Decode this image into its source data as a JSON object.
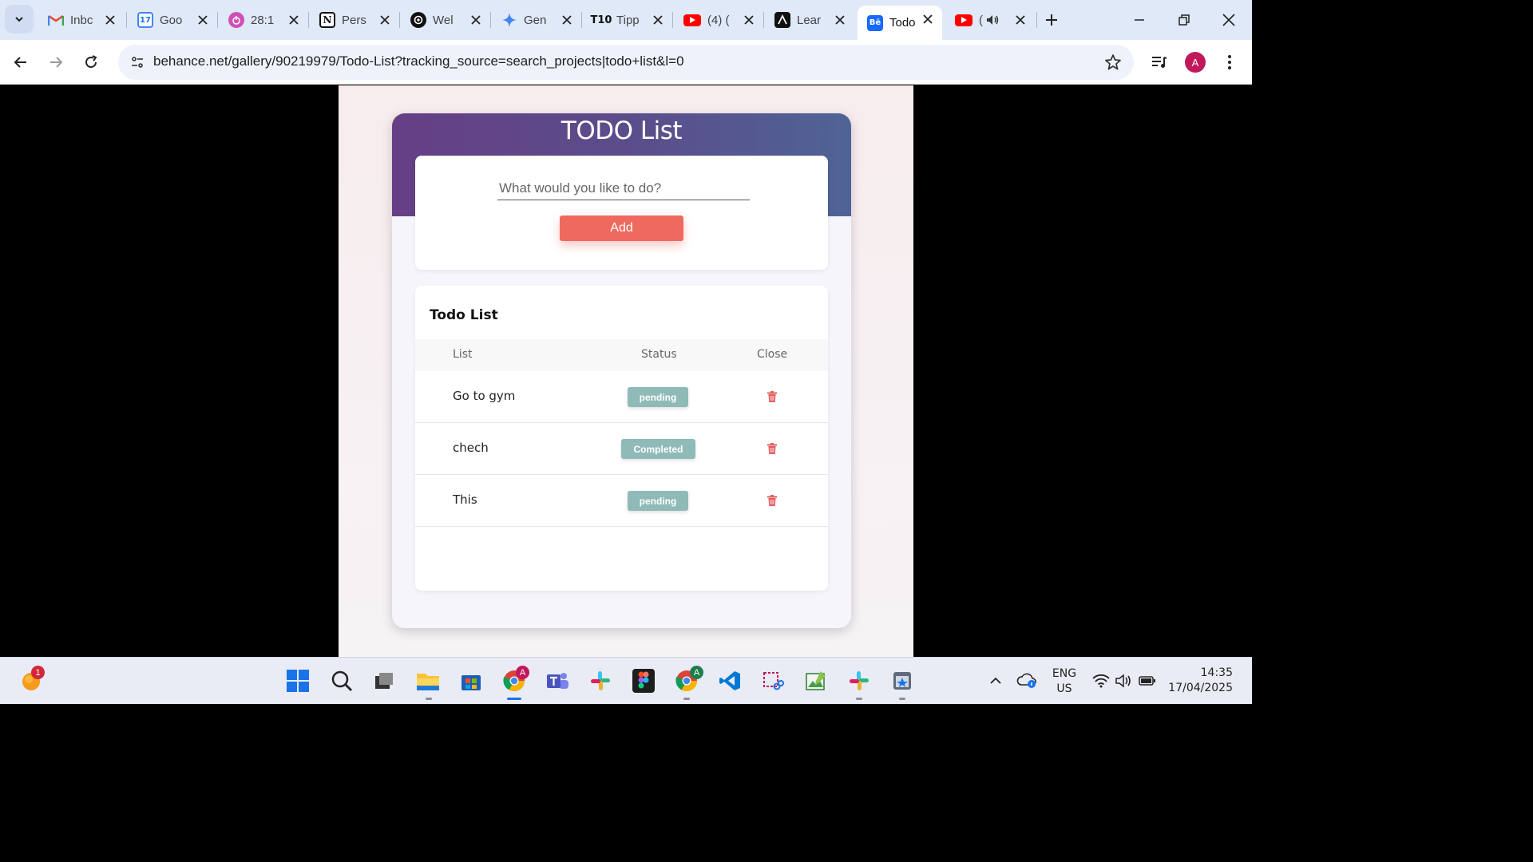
{
  "browser": {
    "tabs": [
      {
        "title": "Inbc",
        "icon": "gmail-icon"
      },
      {
        "title": "Goo",
        "icon": "calendar-icon"
      },
      {
        "title": "28:1",
        "icon": "timer-icon"
      },
      {
        "title": "Pers",
        "icon": "notion-icon"
      },
      {
        "title": "Wel",
        "icon": "openai-icon"
      },
      {
        "title": "Gen",
        "icon": "gemini-icon"
      },
      {
        "title": "Tipp",
        "icon": "t10-icon"
      },
      {
        "title": "(4) (",
        "icon": "youtube-icon"
      },
      {
        "title": "Lear",
        "icon": "academy-icon"
      },
      {
        "title": "Todo",
        "icon": "behance-icon",
        "active": true
      },
      {
        "title": "(",
        "icon": "youtube-icon"
      }
    ],
    "calendar_day": "17",
    "url": "behance.net/gallery/90219979/Todo-List?tracking_source=search_projects|todo+list&l=0",
    "profile_initial": "A"
  },
  "app": {
    "title": "TODO List",
    "input_placeholder": "What would you like to do?",
    "add_label": "Add",
    "list_heading": "Todo List",
    "columns": {
      "list": "List",
      "status": "Status",
      "close": "Close"
    },
    "todos": [
      {
        "text": "Go to gym",
        "status": "pending"
      },
      {
        "text": "chech",
        "status": "Completed"
      },
      {
        "text": "This",
        "status": "pending"
      }
    ]
  },
  "taskbar": {
    "notification_count": "1",
    "chrome_badge": "A",
    "chrome2_badge": "A",
    "language": "ENG",
    "region": "US",
    "time": "14:35",
    "date": "17/04/2025"
  },
  "colors": {
    "header_gradient_start": "#663f85",
    "header_gradient_end": "#4f6397",
    "add_button": "#ee6a5e",
    "status_badge": "#8fbab8",
    "trash": "#e35d5d"
  }
}
